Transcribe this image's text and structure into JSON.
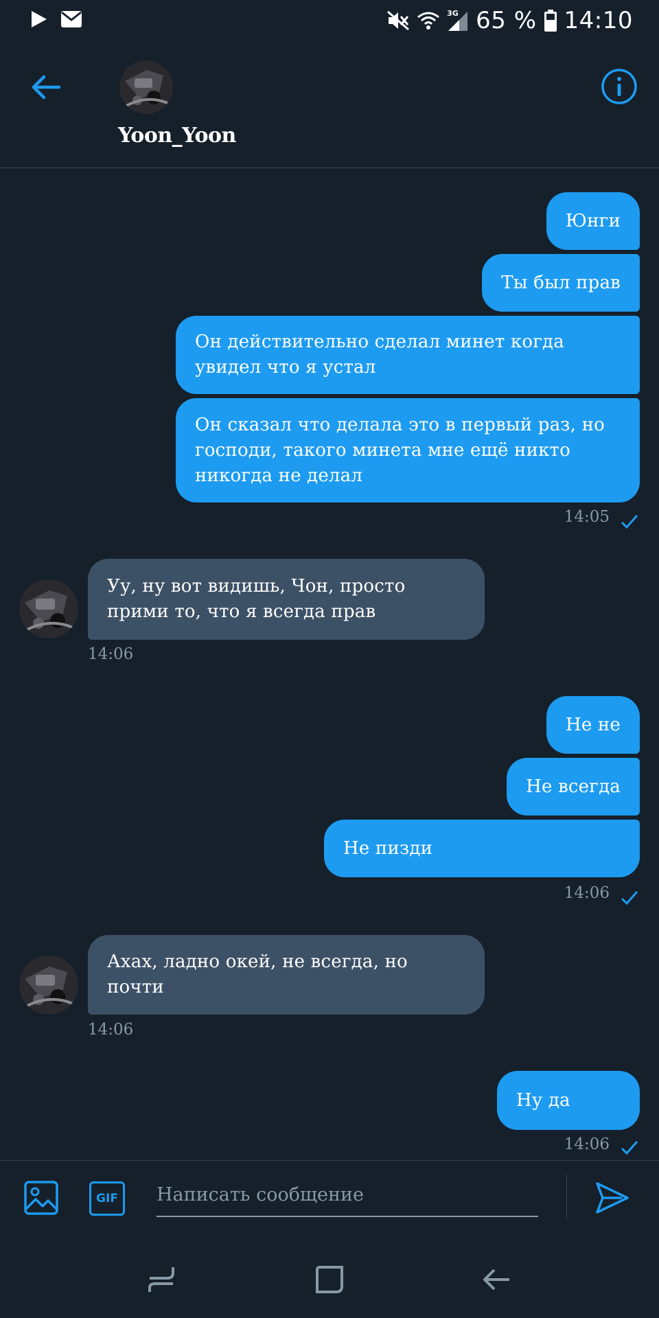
{
  "status_bar": {
    "battery": "65 %",
    "time": "14:10",
    "network": "3G"
  },
  "header": {
    "username": "Yoon_Yoon"
  },
  "messages": [
    {
      "dir": "out",
      "text": "Юнги"
    },
    {
      "dir": "out",
      "text": "Ты был прав"
    },
    {
      "dir": "out",
      "text": "Он действительно сделал минет когда увидел что я устал"
    },
    {
      "dir": "out",
      "text": "Он сказал что делала это в первый раз, но господи, такого минета мне ещё никто никогда не делал"
    },
    {
      "dir": "in",
      "text": "Уу, ну вот видишь, Чон, просто прими то, что я всегда прав"
    },
    {
      "dir": "out",
      "text": "Не не"
    },
    {
      "dir": "out",
      "text": "Не всегда"
    },
    {
      "dir": "out",
      "text": "Не пизди"
    },
    {
      "dir": "in",
      "text": "Ахах, ладно окей, не всегда, но почти"
    },
    {
      "dir": "out",
      "text": "Ну да"
    }
  ],
  "timestamps": [
    "14:05",
    "14:06",
    "14:06",
    "14:06",
    "14:06"
  ],
  "composer": {
    "placeholder": "Написать сообщение",
    "gif_label": "GIF"
  },
  "colors": {
    "background": "#15202b",
    "outgoing_bubble": "#1d9bf0",
    "incoming_bubble": "#3d5166",
    "accent": "#1d9bf0",
    "muted_text": "#8899a6"
  },
  "icons": [
    "play-icon",
    "mail-icon",
    "mute-icon",
    "wifi-icon",
    "signal-icon",
    "battery-icon",
    "back-arrow-icon",
    "info-icon",
    "image-icon",
    "gif-icon",
    "send-icon",
    "recent-apps-icon",
    "home-icon",
    "nav-back-icon"
  ]
}
